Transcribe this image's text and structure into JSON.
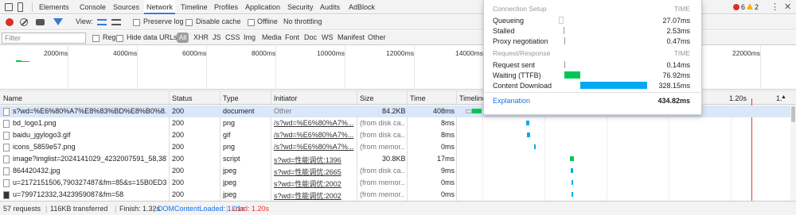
{
  "tabs": [
    "Elements",
    "Console",
    "Sources",
    "Network",
    "Timeline",
    "Profiles",
    "Application",
    "Security",
    "Audits",
    "AdBlock"
  ],
  "active_tab": "Network",
  "badges": {
    "errors": "6",
    "warnings": "2"
  },
  "toolbar": {
    "view_label": "View:",
    "preserve_log": "Preserve log",
    "disable_cache": "Disable cache",
    "offline": "Offline",
    "throttling": "No throttling"
  },
  "filterbar": {
    "placeholder": "Filter",
    "regex": "Regex",
    "hide_data_urls": "Hide data URLs",
    "types": [
      "All",
      "XHR",
      "JS",
      "CSS",
      "Img",
      "Media",
      "Font",
      "Doc",
      "WS",
      "Manifest",
      "Other"
    ]
  },
  "overview_ticks": [
    "2000ms",
    "4000ms",
    "6000ms",
    "8000ms",
    "10000ms",
    "12000ms",
    "14000ms",
    "22000ms"
  ],
  "columns": [
    "Name",
    "Status",
    "Type",
    "Initiator",
    "Size",
    "Time",
    "Timeline"
  ],
  "timeline_ticks": [
    "1.20s",
    "1."
  ],
  "rows": [
    {
      "name": "s?wd=%E6%80%A7%E8%83%BD%E8%B0%8...",
      "status": "200",
      "type": "document",
      "initiator": "Other",
      "size": "84.2KB",
      "time": "408ms",
      "init_link": false,
      "size_grey": false
    },
    {
      "name": "bd_logo1.png",
      "status": "200",
      "type": "png",
      "initiator": "/s?wd=%E6%80%A7%...",
      "size": "(from disk ca...",
      "time": "8ms",
      "init_link": true,
      "size_grey": true
    },
    {
      "name": "baidu_jgylogo3.gif",
      "status": "200",
      "type": "gif",
      "initiator": "/s?wd=%E6%80%A7%...",
      "size": "(from disk ca...",
      "time": "8ms",
      "init_link": true,
      "size_grey": true
    },
    {
      "name": "icons_5859e57.png",
      "status": "200",
      "type": "png",
      "initiator": "/s?wd=%E6%80%A7%...",
      "size": "(from memor...",
      "time": "0ms",
      "init_link": true,
      "size_grey": true
    },
    {
      "name": "image?imglist=2024141029_4232007591_58,387...",
      "status": "200",
      "type": "script",
      "initiator": "s?wd=性能调优:1396",
      "size": "30.8KB",
      "time": "17ms",
      "init_link": true,
      "size_grey": false
    },
    {
      "name": "864420432.jpg",
      "status": "200",
      "type": "jpeg",
      "initiator": "s?wd=性能调优:2665",
      "size": "(from disk ca...",
      "time": "9ms",
      "init_link": true,
      "size_grey": true
    },
    {
      "name": "u=2172151506,790327487&fm=85&s=15B0ED33...",
      "status": "200",
      "type": "jpeg",
      "initiator": "s?wd=性能调优:2002",
      "size": "(from memor...",
      "time": "0ms",
      "init_link": true,
      "size_grey": true
    },
    {
      "name": "u=799712332,3423959087&fm=58",
      "status": "200",
      "type": "jpeg",
      "initiator": "s?wd=性能调优:2002",
      "size": "(from memor...",
      "time": "0ms",
      "init_link": true,
      "size_grey": true
    }
  ],
  "status": {
    "requests": "57 requests",
    "transferred": "116KB transferred",
    "finish": "Finish: 1.32s",
    "dcl": "DOMContentLoaded: 1.01s",
    "load": "Load: 1.20s"
  },
  "popover": {
    "section1": "Connection Setup",
    "time1": "TIME",
    "queueing_label": "Queueing",
    "queueing_value": "27.07ms",
    "stalled_label": "Stalled",
    "stalled_value": "2.53ms",
    "proxy_label": "Proxy negotiation",
    "proxy_value": "0.47ms",
    "section2": "Request/Response",
    "time2": "TIME",
    "sent_label": "Request sent",
    "sent_value": "0.14ms",
    "ttfb_label": "Waiting (TTFB)",
    "ttfb_value": "76.92ms",
    "download_label": "Content Download",
    "download_value": "328.15ms",
    "explanation": "Explanation",
    "total": "434.82ms"
  },
  "colors": {
    "accent": "#3879d9",
    "ttfb": "#00c853",
    "download": "#03a9f4",
    "load": "#e53935",
    "dcl": "#1a73e8"
  }
}
